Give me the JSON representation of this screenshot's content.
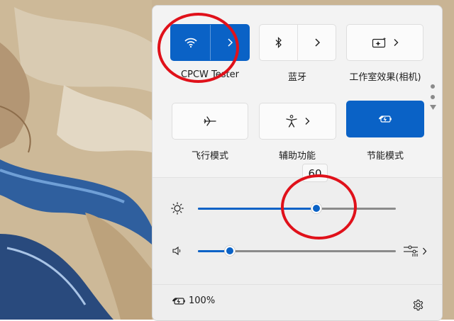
{
  "quick_settings": {
    "tiles": [
      {
        "id": "wifi",
        "label": "CPCW Tester",
        "icon": "wifi-icon",
        "active": true,
        "has_chevron": true
      },
      {
        "id": "bluetooth",
        "label": "蓝牙",
        "icon": "bluetooth-icon",
        "active": false,
        "has_chevron": true
      },
      {
        "id": "studio-effects",
        "label": "工作室效果(相机)",
        "icon": "studio-effects-icon",
        "active": false,
        "has_chevron": true
      },
      {
        "id": "airplane",
        "label": "飞行模式",
        "icon": "airplane-icon",
        "active": false,
        "has_chevron": false
      },
      {
        "id": "accessibility",
        "label": "辅助功能",
        "icon": "accessibility-icon",
        "active": false,
        "has_chevron": true
      },
      {
        "id": "energy-saver",
        "label": "节能模式",
        "icon": "energy-saver-icon",
        "active": true,
        "has_chevron": false
      }
    ],
    "brightness": {
      "icon": "brightness-icon",
      "value": 60,
      "tooltip": "60"
    },
    "volume": {
      "icon": "speaker-icon",
      "value": 16,
      "output_icon": "audio-output-icon"
    },
    "battery": {
      "icon": "battery-saver-icon",
      "percent_text": "100%"
    },
    "settings_icon": "gear-icon",
    "page_indicator": {
      "pages": 2,
      "current": 1
    }
  },
  "colors": {
    "accent": "#0a62c6",
    "annotation": "#e0111a",
    "panel_bg": "#f3f3f3"
  }
}
